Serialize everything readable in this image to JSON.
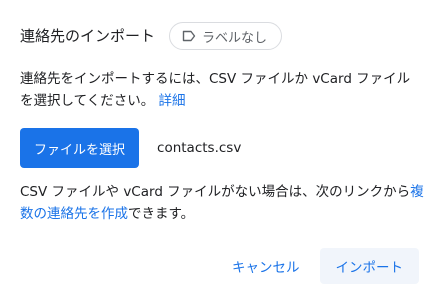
{
  "dialog": {
    "title": "連絡先のインポート",
    "label_chip": {
      "icon": "label-outline-icon",
      "text": "ラベルなし"
    },
    "description": {
      "text": "連絡先をインポートするには、CSV ファイルか vCard ファイルを選択してください。",
      "link": "詳細"
    },
    "file": {
      "select_button": "ファイルを選択",
      "selected_name": "contacts.csv"
    },
    "note": {
      "before": "CSV ファイルや vCard ファイルがない場合は、次のリンクから",
      "link": "複数の連絡先を作成",
      "after": "できます。"
    },
    "actions": {
      "cancel": "キャンセル",
      "import": "インポート"
    }
  },
  "colors": {
    "accent": "#1a73e8",
    "text": "#202124",
    "muted": "#5f6368",
    "chip_border": "#dadce0",
    "import_bg": "#f1f5fb"
  }
}
